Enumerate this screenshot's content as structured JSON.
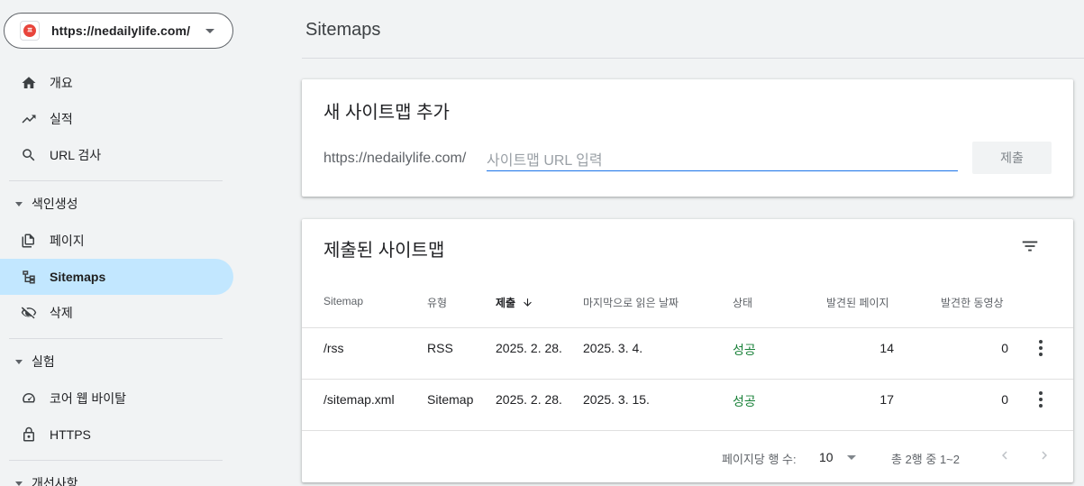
{
  "property": {
    "url": "https://nedailylife.com/"
  },
  "sidebar": {
    "top_items": [
      {
        "label": "개요",
        "icon": "home-icon"
      },
      {
        "label": "실적",
        "icon": "trending-up-icon"
      },
      {
        "label": "URL 검사",
        "icon": "search-icon"
      }
    ],
    "sections": [
      {
        "label": "색인생성",
        "items": [
          {
            "label": "페이지",
            "icon": "pages-icon"
          },
          {
            "label": "Sitemaps",
            "icon": "sitemap-icon",
            "active": true
          },
          {
            "label": "삭제",
            "icon": "visibility-off-icon"
          }
        ]
      },
      {
        "label": "실험",
        "items": [
          {
            "label": "코어 웹 바이탈",
            "icon": "speed-icon"
          },
          {
            "label": "HTTPS",
            "icon": "lock-icon"
          }
        ]
      },
      {
        "label": "개선사항"
      }
    ]
  },
  "page": {
    "title": "Sitemaps"
  },
  "add_card": {
    "title": "새 사이트맵 추가",
    "prefix": "https://nedailylife.com/",
    "input_value": "",
    "input_placeholder": "사이트맵 URL 입력",
    "submit_label": "제출"
  },
  "submitted_card": {
    "title": "제출된 사이트맵",
    "columns": {
      "sitemap": "Sitemap",
      "type": "유형",
      "submitted": "제출",
      "last_read": "마지막으로 읽은 날짜",
      "status": "상태",
      "pages": "발견된 페이지",
      "videos": "발견한 동영상"
    },
    "rows": [
      {
        "sitemap": "/rss",
        "type": "RSS",
        "submitted": "2025. 2. 28.",
        "last_read": "2025. 3. 4.",
        "status": "성공",
        "pages": "14",
        "videos": "0"
      },
      {
        "sitemap": "/sitemap.xml",
        "type": "Sitemap",
        "submitted": "2025. 2. 28.",
        "last_read": "2025. 3. 15.",
        "status": "성공",
        "pages": "17",
        "videos": "0"
      }
    ],
    "footer": {
      "rows_per_page_label": "페이지당 행 수:",
      "rows_per_page_value": "10",
      "range": "총 2행 중 1~2"
    }
  },
  "colors": {
    "accent": "#1a73e8",
    "active_nav": "#c2e7ff",
    "success": "#188038",
    "background": "#f1f3f4"
  }
}
